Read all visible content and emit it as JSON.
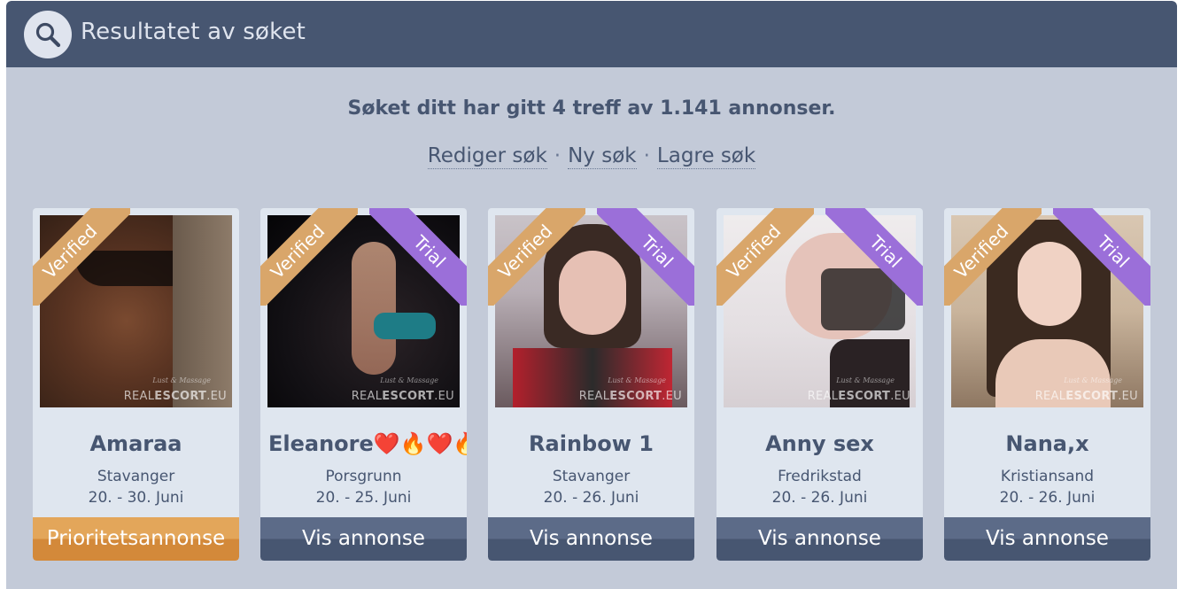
{
  "header": {
    "title": "Resultatet av søket",
    "icon": "search-icon"
  },
  "summary": {
    "text": "Søket ditt har gitt 4 treff av 1.141 annonser."
  },
  "actions": {
    "edit": "Rediger søk",
    "new": "Ny søk",
    "save": "Lagre søk",
    "separator": "·"
  },
  "ribbons": {
    "verified": "Verified",
    "trial": "Trial"
  },
  "watermark": {
    "brand_light": "REAL",
    "brand_bold": "ESCORT",
    "brand_suffix": ".EU",
    "tagline": "Lust & Massage"
  },
  "colors": {
    "header_bg": "#475671",
    "panel_bg": "#c3cad8",
    "card_bg": "#dfe6ef",
    "verified_ribbon": "#d9a66a",
    "trial_ribbon": "#9b6fd9",
    "priority_button": "#e3a65a",
    "view_button": "#475671"
  },
  "listings": [
    {
      "name": "Amaraa",
      "city": "Stavanger",
      "dates": "20. - 30. Juni",
      "button": "Prioritetsannonse",
      "verified": true,
      "trial": false
    },
    {
      "name": "Eleanore❤️🔥❤️🔥",
      "city": "Porsgrunn",
      "dates": "20. - 25. Juni",
      "button": "Vis annonse",
      "verified": true,
      "trial": true
    },
    {
      "name": "Rainbow 1",
      "city": "Stavanger",
      "dates": "20. - 26. Juni",
      "button": "Vis annonse",
      "verified": true,
      "trial": true
    },
    {
      "name": "Anny sex",
      "city": "Fredrikstad",
      "dates": "20. - 26. Juni",
      "button": "Vis annonse",
      "verified": true,
      "trial": true
    },
    {
      "name": "Nana,x",
      "city": "Kristiansand",
      "dates": "20. - 26. Juni",
      "button": "Vis annonse",
      "verified": true,
      "trial": true
    }
  ]
}
